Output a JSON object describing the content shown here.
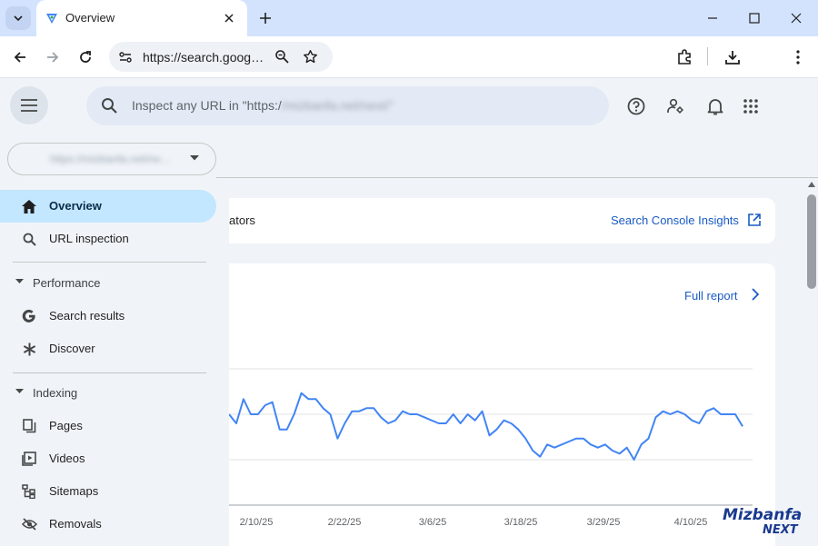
{
  "browser": {
    "tab_title": "Overview",
    "url": "https://search.goog…",
    "icons": [
      "tab-search-icon",
      "favicon-icon",
      "close-icon",
      "plus-icon",
      "minimize-icon",
      "maximize-icon",
      "close-window-icon",
      "back-icon",
      "forward-icon",
      "reload-icon",
      "site-info-icon",
      "zoom-icon",
      "star-icon",
      "extensions-icon",
      "download-icon",
      "more-vert-icon"
    ]
  },
  "header": {
    "search_placeholder_prefix": "Inspect any URL in \"https:/",
    "search_placeholder_blurred": "/mizbanfa.net/next/\"",
    "icons": [
      "menu-icon",
      "help-icon",
      "manage-users-icon",
      "notifications-icon",
      "apps-icon"
    ]
  },
  "property": {
    "label_blurred": "https://mizbanfa.net/ne…",
    "caret_icon": "arrow-drop-down-icon"
  },
  "sidebar": {
    "items": [
      {
        "label": "Overview",
        "icon": "home-icon",
        "active": true
      },
      {
        "label": "URL inspection",
        "icon": "search-icon"
      }
    ],
    "performance": {
      "title": "Performance",
      "items": [
        {
          "label": "Search results",
          "icon": "google-g-icon"
        },
        {
          "label": "Discover",
          "icon": "asterisk-icon"
        }
      ]
    },
    "indexing": {
      "title": "Indexing",
      "items": [
        {
          "label": "Pages",
          "icon": "pages-icon"
        },
        {
          "label": "Videos",
          "icon": "videos-icon"
        },
        {
          "label": "Sitemaps",
          "icon": "sitemap-icon"
        },
        {
          "label": "Removals",
          "icon": "removals-icon"
        }
      ]
    }
  },
  "main": {
    "card1_text": "ators",
    "insights_link": "Search Console Insights",
    "full_report_link": "Full report"
  },
  "chart_data": {
    "type": "line",
    "x_tick_labels": [
      "2/10/25",
      "2/22/25",
      "3/6/25",
      "3/18/25",
      "3/29/25",
      "4/10/25"
    ],
    "gridlines": 3,
    "grid": true,
    "series": [
      {
        "color": "#4285f4",
        "values": [
          100,
          97,
          105,
          100,
          100,
          103,
          104,
          95,
          95,
          100,
          107,
          105,
          105,
          102,
          100,
          92,
          97,
          101,
          101,
          102,
          102,
          99,
          97,
          98,
          101,
          100,
          100,
          99,
          98,
          97,
          97,
          100,
          97,
          100,
          98,
          101,
          93,
          95,
          98,
          97,
          95,
          92,
          88,
          86,
          90,
          89,
          90,
          91,
          92,
          92,
          90,
          89,
          90,
          88,
          87,
          89,
          85,
          90,
          92,
          99,
          101,
          100,
          101,
          100,
          98,
          97,
          101,
          102,
          100,
          100,
          100,
          96
        ]
      }
    ],
    "line_color": "#4285f4",
    "grid_color": "#e0e3e7",
    "axis_color": "#9aa0a6"
  },
  "watermark": {
    "line1": "Mizbanfa",
    "line2": "NEXT"
  }
}
